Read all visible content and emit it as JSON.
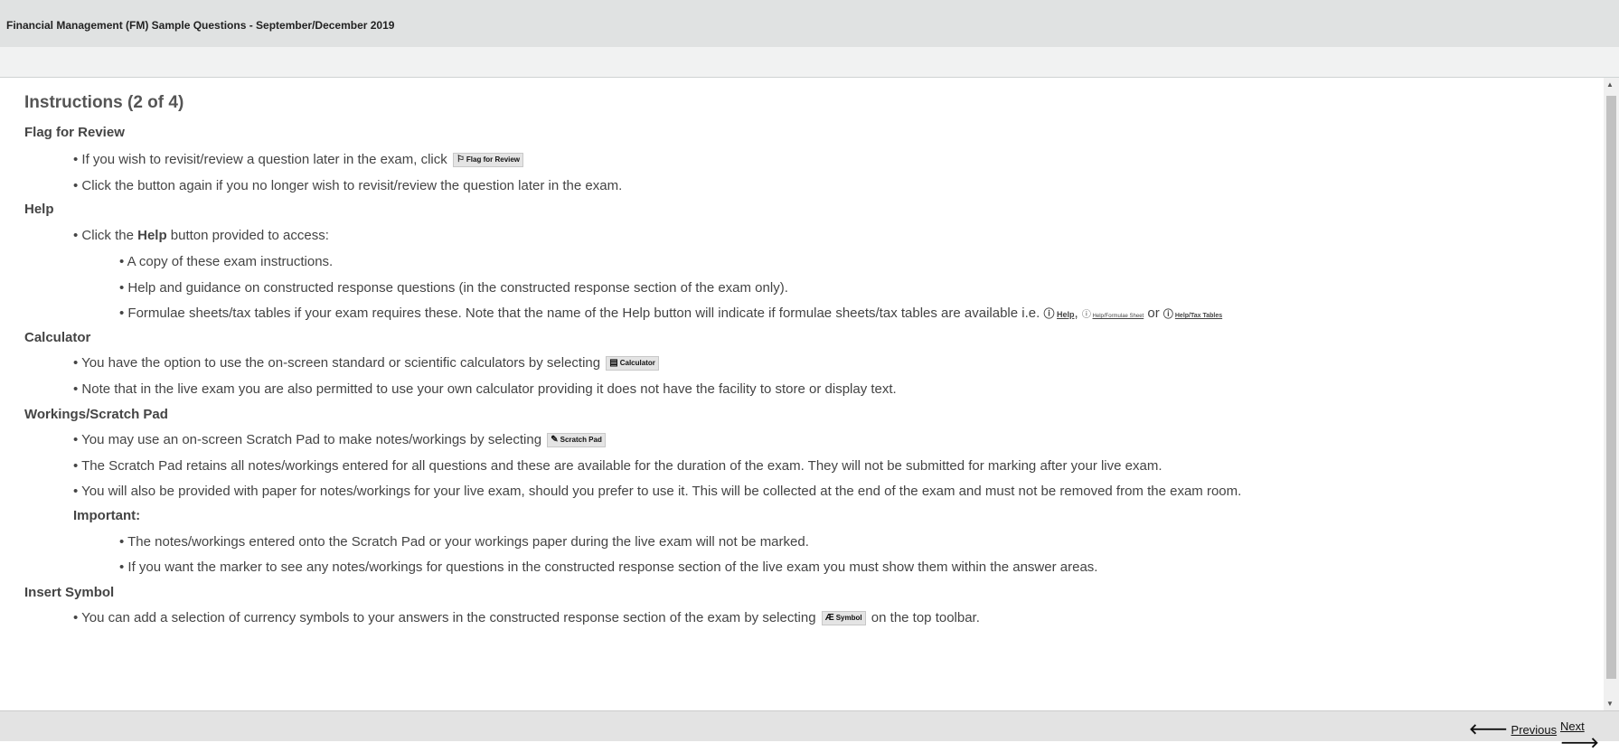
{
  "header": {
    "title": "Financial Management (FM) Sample Questions - September/December 2019"
  },
  "heading": "Instructions (2 of 4)",
  "sections": {
    "flag": {
      "title": "Flag for Review",
      "line1": "• If you wish to revisit/review a question later in the exam, click",
      "button": "Flag for Review",
      "line2": "• Click the button again if you no longer wish to revisit/review the question later in the exam."
    },
    "help": {
      "title": "Help",
      "line1_pre": "• Click the ",
      "line1_bold": "Help",
      "line1_post": " button provided to access:",
      "sub1": "• A copy of these exam instructions.",
      "sub2": "• Help and guidance on constructed response questions (in the constructed response section of the exam only).",
      "sub3": "• Formulae sheets/tax tables if your exam requires these. Note that the name of the Help button will indicate if formulae sheets/tax tables are available i.e.",
      "btn_help": "Help",
      "sep1": ",",
      "btn_formulae": "Help/Formulae Sheet",
      "sep2": "or",
      "btn_tax": "Help/Tax Tables"
    },
    "calculator": {
      "title": "Calculator",
      "line1": "• You have the option to use the on-screen standard or scientific calculators by selecting",
      "button": "Calculator",
      "line2": "• Note that in the live exam you are also permitted to use your own calculator providing it does not have the facility to store or display text."
    },
    "workings": {
      "title": "Workings/Scratch Pad",
      "line1": "• You may use an on-screen Scratch Pad to make notes/workings by selecting",
      "button": "Scratch Pad",
      "line2": "• The Scratch Pad retains all notes/workings entered for all questions and these are available for the duration of the exam. They will not be submitted for marking after your live exam.",
      "line3": "• You will also be provided with paper for notes/workings for your live exam, should you prefer to use it. This will be collected at the end of the exam and must not be removed from the exam room.",
      "important": "Important:",
      "imp1": "• The notes/workings entered onto the Scratch Pad or your workings paper during the live exam will not be marked.",
      "imp2": "• If you want the marker to see any notes/workings for questions in the constructed response section of the live exam you must show them within the answer areas."
    },
    "symbol": {
      "title": "Insert Symbol",
      "line1": "• You can add a selection of currency symbols to your answers in the constructed response section of the exam by selecting",
      "button": "Symbol",
      "line1_post": "on the top toolbar."
    }
  },
  "nav": {
    "previous": "Previous",
    "next": "Next"
  }
}
